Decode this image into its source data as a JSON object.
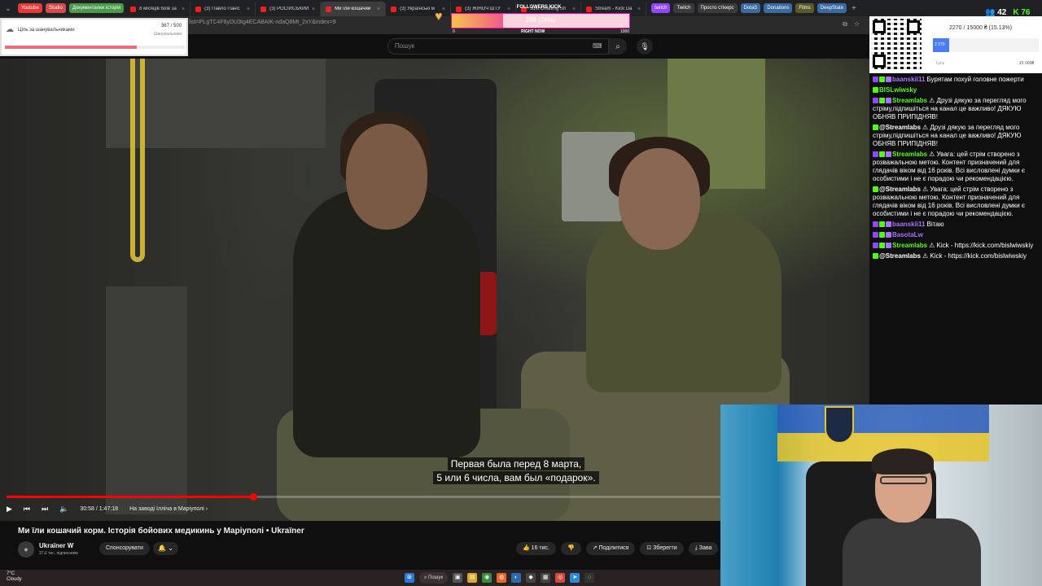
{
  "browser": {
    "bookmarks": [
      {
        "label": "Youtube",
        "color": "#e43a3a"
      },
      {
        "label": "Studio",
        "color": "#d24a4a"
      },
      {
        "label": "Документалки історія",
        "color": "#4a9a4a"
      }
    ],
    "tabs": [
      {
        "label": "8 місяців боїв за",
        "active": false
      },
      {
        "label": "(3) Павло Паніс",
        "active": false
      },
      {
        "label": "(3) РОСІЙСЬКИЙ",
        "active": false
      },
      {
        "label": "Ми їли кошачий",
        "active": true
      },
      {
        "label": "(3) Українські м",
        "active": false
      },
      {
        "label": "(3) ЖІНОЧ ШТУ",
        "active": false
      },
      {
        "label": "Just Chatting Sh",
        "active": false
      },
      {
        "label": "Stream - Kick Da",
        "active": false
      }
    ],
    "right_bookmarks": [
      {
        "label": "twitch",
        "color": "#9147ff"
      },
      {
        "label": "Twitch",
        "color": "#3a3a3a"
      },
      {
        "label": "Просто стікерс",
        "color": "#3a3a3a"
      },
      {
        "label": "DotaS",
        "color": "#3a6aa0"
      },
      {
        "label": "Donations",
        "color": "#3a6aa0"
      },
      {
        "label": "Films",
        "color": "#5a5a2a"
      },
      {
        "label": "DeepState",
        "color": "#3a6aa0"
      }
    ],
    "url": "list=PLgTC4F8yDU3Ig4ECABAIK-ndaQ8Mt_2xY&index=9"
  },
  "youtube": {
    "search_placeholder": "Пошук",
    "subtitle_line1": "Первая была перед 8 марта,",
    "subtitle_line2": "5 или 6 числа, вам был «подарок».",
    "time": "30:58 / 1:47:18",
    "chapter": "На заводі Ілліча в Маріуполі",
    "progress_fraction": 0.288,
    "video_title": "Ми їли кошачий корм. Історія бойових медикинь у Маріуполі • Ukraїner",
    "channel_name": "Ukraїner W",
    "channel_subs": "37,6 тис. підписників",
    "sponsor_label": "Спонсорувати",
    "likes": "16 тис.",
    "share_label": "Поділитися",
    "save_label": "Зберегти",
    "download_label": "Зава"
  },
  "goal_widget": {
    "label": "Ціль за шанувальниками",
    "count": "367 / 500",
    "sublabel": "Шанувальники",
    "fraction": 0.734
  },
  "followers_widget": {
    "label": "FOLLOWERS KICK",
    "value": "289 (28%)",
    "min": "0",
    "now": "RIGHT NOW",
    "max": "1000",
    "fraction": 0.289
  },
  "donation_widget": {
    "text": "2270 / 15000 ₴ (15.13%)",
    "bar_label": "2 270",
    "min": "Ціль",
    "max": "15 000₴",
    "fraction": 0.1513
  },
  "viewers": {
    "twitch": "42",
    "kick": "76"
  },
  "chat": [
    {
      "user": "baanskii11",
      "color": "#a970ff",
      "badges": [
        "#9147ff",
        "#53fc18",
        "#a970ff"
      ],
      "text": "Бурятам похуй головне пожерти"
    },
    {
      "user": "BISLwiwsky",
      "color": "#53fc18",
      "badges": [
        "#53fc18"
      ],
      "text": ""
    },
    {
      "user": "Streamlabs",
      "color": "#53fc18",
      "badges": [
        "#9147ff",
        "#53fc18",
        "#a970ff"
      ],
      "text": "⚠ Друзі дякую за перегляд мого стріму,підпишіться на канал це важливо! ДЯКУЮ ОБНЯВ ПРИПІДНЯВ!"
    },
    {
      "user": "@Streamlabs",
      "color": "#ffffff",
      "badges": [
        "#53fc18"
      ],
      "text": "⚠ Друзі дякую за перегляд мого стріму,підпишіться на канал це важливо! ДЯКУЮ ОБНЯВ ПРИПІДНЯВ!"
    },
    {
      "user": "Streamlabs",
      "color": "#53fc18",
      "badges": [
        "#9147ff",
        "#53fc18",
        "#a970ff"
      ],
      "text": "⚠ Увага: цей стрім створено з розважальною метою. Контент призначений для глядачів віком від 16 років. Всі висловлені думки є особистими і не є порадою чи рекомендацією."
    },
    {
      "user": "@Streamlabs",
      "color": "#ffffff",
      "badges": [
        "#53fc18"
      ],
      "text": "⚠ Увага: цей стрім створено з розважальною метою. Контент призначений для глядачів віком від 16 років. Всі висловлені думки є особистими і не є порадою чи рекомендацією."
    },
    {
      "user": "baanskii11",
      "color": "#a970ff",
      "badges": [
        "#9147ff",
        "#53fc18",
        "#a970ff"
      ],
      "text": "Вітаю"
    },
    {
      "user": "BasotaLw",
      "color": "#a970ff",
      "badges": [
        "#9147ff",
        "#53fc18",
        "#a970ff"
      ],
      "text": ""
    },
    {
      "user": "Streamlabs",
      "color": "#53fc18",
      "badges": [
        "#9147ff",
        "#53fc18",
        "#a970ff"
      ],
      "text": "⚠ Kick - https://kick.com/bislwiwskiy"
    },
    {
      "user": "@Streamlabs",
      "color": "#ffffff",
      "badges": [
        "#53fc18"
      ],
      "text": "⚠ Kick - https://kick.com/bislwiwskiy"
    }
  ],
  "taskbar": {
    "weather_temp": "7°C",
    "weather_desc": "Cloudy",
    "search_label": "Пошук"
  }
}
